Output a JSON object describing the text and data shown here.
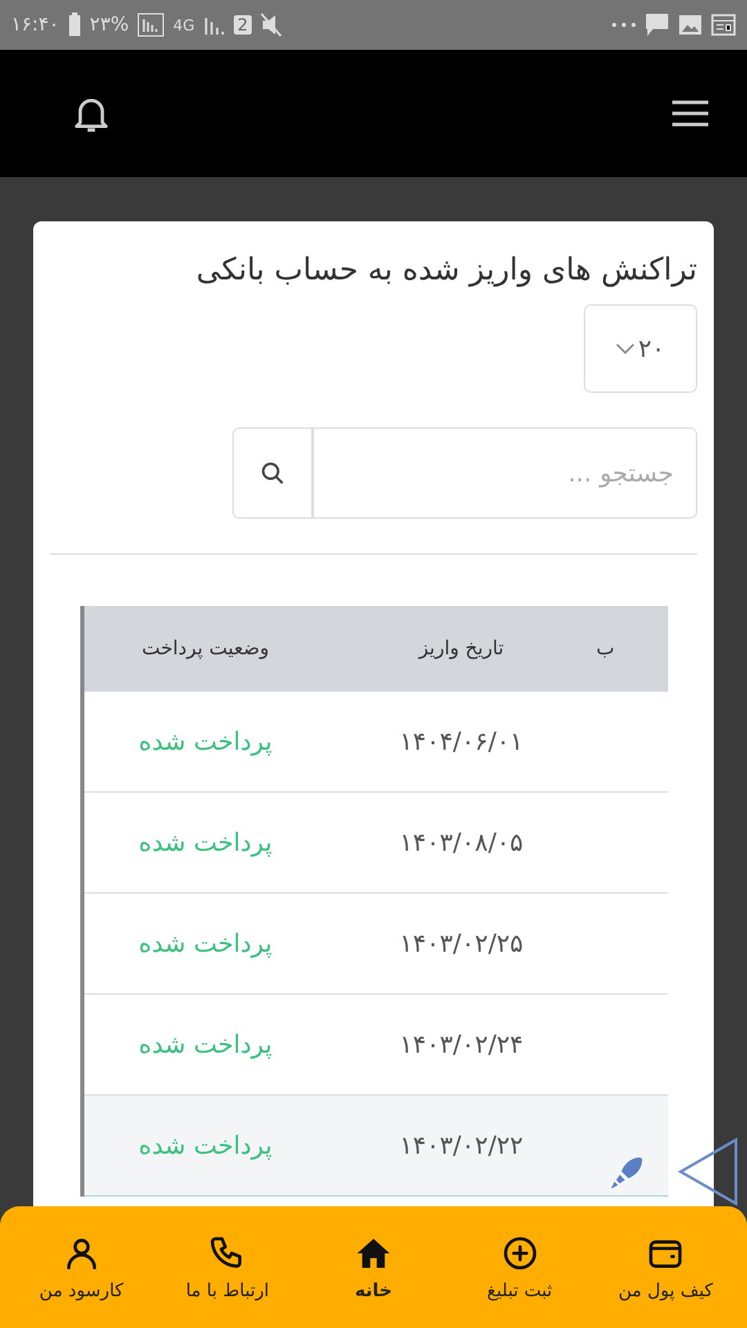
{
  "status_bar": {
    "time": "۱۶:۴۰",
    "battery": "۲۳%",
    "network": "4G",
    "sim": "2"
  },
  "page": {
    "title": "تراکنش های واریز شده به حساب بانکی"
  },
  "page_size": {
    "value": "۲۰"
  },
  "search": {
    "placeholder": "جستجو ..."
  },
  "table": {
    "columns": [
      "ب",
      "تاریخ واریز",
      "وضعیت پرداخت"
    ],
    "rows": [
      {
        "date": "۱۴۰۴/۰۶/۰۱",
        "status": "پرداخت شده",
        "highlighted": false
      },
      {
        "date": "۱۴۰۳/۰۸/۰۵",
        "status": "پرداخت شده",
        "highlighted": false
      },
      {
        "date": "۱۴۰۳/۰۲/۲۵",
        "status": "پرداخت شده",
        "highlighted": false
      },
      {
        "date": "۱۴۰۳/۰۲/۲۴",
        "status": "پرداخت شده",
        "highlighted": false
      },
      {
        "date": "۱۴۰۳/۰۲/۲۲",
        "status": "پرداخت شده",
        "highlighted": true
      }
    ]
  },
  "bottom_nav": [
    {
      "kind": "wallet",
      "label": "کیف پول من",
      "selected": false
    },
    {
      "kind": "add",
      "label": "ثبت تبلیغ",
      "selected": false
    },
    {
      "kind": "home",
      "label": "خانه",
      "selected": true
    },
    {
      "kind": "phone",
      "label": "ارتباط با ما",
      "selected": false
    },
    {
      "kind": "user",
      "label": "کارسود من",
      "selected": false
    }
  ]
}
